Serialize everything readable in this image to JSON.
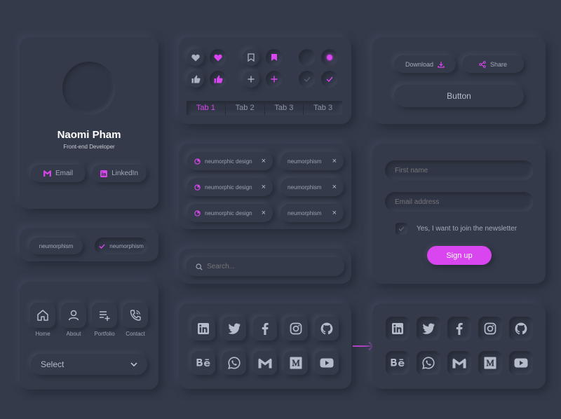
{
  "profile": {
    "name": "Naomi Pham",
    "role": "Front-end Developer",
    "email_label": "Email",
    "linkedin_label": "LinkedIn"
  },
  "toggle_chips": [
    "neumorphism",
    "neumorphism"
  ],
  "nav": {
    "items": [
      {
        "label": "Home",
        "icon": "home-icon"
      },
      {
        "label": "About",
        "icon": "user-icon"
      },
      {
        "label": "Portfolio",
        "icon": "playlist-add-icon"
      },
      {
        "label": "Contact",
        "icon": "phone-icon"
      }
    ],
    "select_label": "Select"
  },
  "tabs": [
    "Tab 1",
    "Tab 2",
    "Tab 3",
    "Tab 3"
  ],
  "tags": {
    "left": [
      "neumorphic design",
      "neumorphic design",
      "neumorphic design"
    ],
    "right": [
      "neumorphism",
      "neumorphism",
      "neumorphism"
    ],
    "close": "×"
  },
  "search": {
    "placeholder": "Search..."
  },
  "buttons": {
    "download": "Download",
    "share": "Share",
    "button": "Button"
  },
  "form": {
    "first_name_placeholder": "First name",
    "email_placeholder": "Email address",
    "newsletter_label": "Yes, I want to join the newsletter",
    "signup_label": "Sign up"
  },
  "social_icons": [
    "linkedin-icon",
    "twitter-icon",
    "facebook-icon",
    "instagram-icon",
    "github-icon",
    "behance-icon",
    "whatsapp-icon",
    "gmail-icon",
    "medium-icon",
    "youtube-icon"
  ],
  "colors": {
    "background": "#343a4a",
    "accent": "#d946ef",
    "text": "#9aa1b1"
  }
}
